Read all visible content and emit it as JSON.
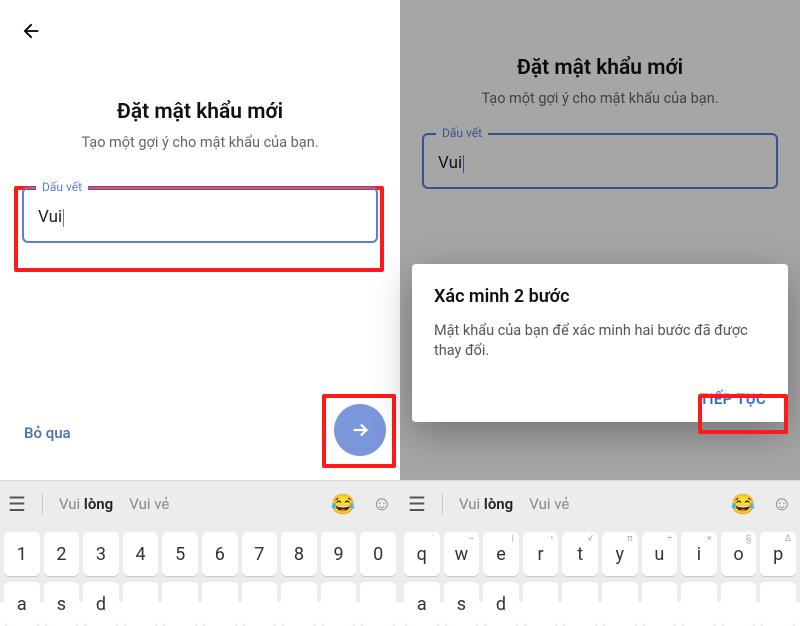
{
  "left": {
    "title": "Đặt mật khẩu mới",
    "subtitle": "Tạo một gợi ý cho mật khẩu của bạn.",
    "input": {
      "label": "Dấu vết",
      "value": "Vui"
    },
    "skip": "Bỏ qua"
  },
  "right": {
    "title": "Đặt mật khẩu mới",
    "subtitle": "Tạo một gợi ý cho mật khẩu của bạn.",
    "input": {
      "label": "Dấu vết",
      "value": "Vui"
    },
    "dialog": {
      "title": "Xác minh 2 bước",
      "body": "Mật khẩu của bạn để xác minh hai bước đã được thay đổi.",
      "action": "TIẾP TỤC"
    }
  },
  "keyboard": {
    "drawer_icon": "☰",
    "suggestions": [
      {
        "prefix": "Vui ",
        "bold": "lòng"
      },
      {
        "prefix": "Vui ",
        "light": "vẻ"
      }
    ],
    "emoji": "😂",
    "smile": "☺",
    "num_row": [
      "1",
      "2",
      "3",
      "4",
      "5",
      "6",
      "7",
      "8",
      "9",
      "0"
    ],
    "letter_row": [
      "q",
      "w",
      "e",
      "r",
      "t",
      "y",
      "u",
      "i",
      "o",
      "p"
    ],
    "letter_hints": [
      "`",
      "~",
      "|",
      "•",
      "√",
      "π",
      "÷",
      "×",
      "§",
      "∆"
    ],
    "row3": [
      "a",
      "s",
      "d"
    ]
  },
  "colors": {
    "accent": "#5a7fd8",
    "highlight": "#ff1a1a"
  }
}
